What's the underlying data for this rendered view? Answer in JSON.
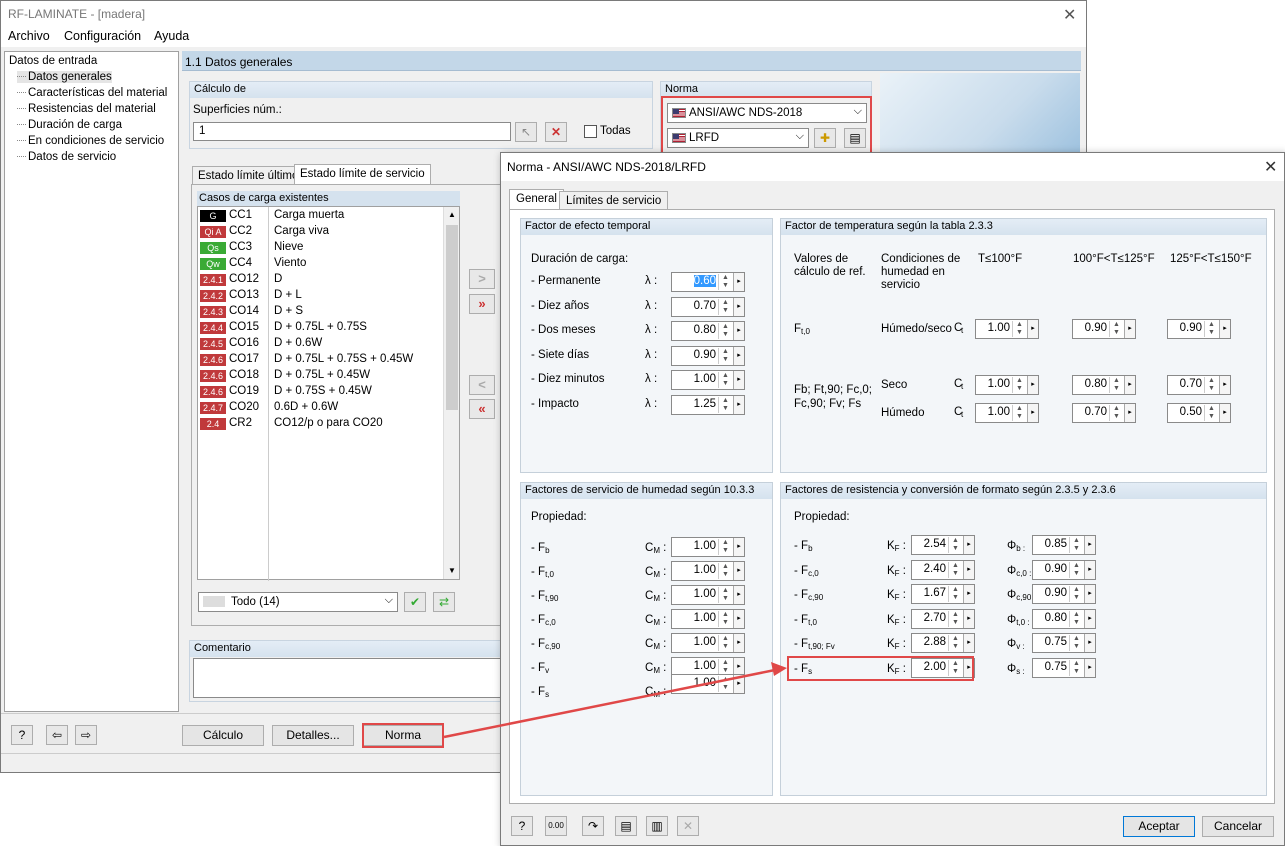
{
  "main": {
    "title": "RF-LAMINATE - [madera]",
    "menu": [
      "Archivo",
      "Configuración",
      "Ayuda"
    ],
    "tree": {
      "root": "Datos de entrada",
      "items": [
        "Datos generales",
        "Características del material",
        "Resistencias del material",
        "Duración de carga",
        "En condiciones de servicio",
        "Datos de servicio"
      ]
    },
    "section_title": "1.1 Datos generales",
    "calc": {
      "header": "Cálculo de",
      "surfaces_label": "Superficies núm.:",
      "surfaces_value": "1",
      "all_label": "Todas"
    },
    "norma": {
      "header": "Norma",
      "standard": "ANSI/AWC NDS-2018",
      "method": "LRFD"
    },
    "tabs": [
      "Estado límite último",
      "Estado límite de servicio"
    ],
    "cases_header": "Casos de carga existentes",
    "cases": [
      {
        "tag": "G",
        "tag_color": "#000000",
        "id": "CC1",
        "desc": "Carga muerta"
      },
      {
        "tag": "Qi A",
        "tag_color": "#c0393b",
        "id": "CC2",
        "desc": "Carga viva"
      },
      {
        "tag": "Qs",
        "tag_color": "#3aaa35",
        "id": "CC3",
        "desc": "Nieve"
      },
      {
        "tag": "Qw",
        "tag_color": "#3aaa35",
        "id": "CC4",
        "desc": "Viento"
      },
      {
        "tag": "2.4.1",
        "tag_color": "#c0393b",
        "id": "CO12",
        "desc": "D"
      },
      {
        "tag": "2.4.2",
        "tag_color": "#c0393b",
        "id": "CO13",
        "desc": "D + L"
      },
      {
        "tag": "2.4.3",
        "tag_color": "#c0393b",
        "id": "CO14",
        "desc": "D + S"
      },
      {
        "tag": "2.4.4",
        "tag_color": "#c0393b",
        "id": "CO15",
        "desc": "D + 0.75L + 0.75S"
      },
      {
        "tag": "2.4.5",
        "tag_color": "#c0393b",
        "id": "CO16",
        "desc": "D + 0.6W"
      },
      {
        "tag": "2.4.6",
        "tag_color": "#c0393b",
        "id": "CO17",
        "desc": "D + 0.75L + 0.75S + 0.45W"
      },
      {
        "tag": "2.4.6",
        "tag_color": "#c0393b",
        "id": "CO18",
        "desc": "D + 0.75L + 0.45W"
      },
      {
        "tag": "2.4.6",
        "tag_color": "#c0393b",
        "id": "CO19",
        "desc": "D + 0.75S + 0.45W"
      },
      {
        "tag": "2.4.7",
        "tag_color": "#c0393b",
        "id": "CO20",
        "desc": "0.6D + 0.6W"
      },
      {
        "tag": "2.4",
        "tag_color": "#c0393b",
        "id": "CR2",
        "desc": "CO12/p o para CO20"
      }
    ],
    "filter": "Todo (14)",
    "comment_label": "Comentario",
    "buttons": {
      "calc": "Cálculo",
      "details": "Detalles...",
      "norma": "Norma"
    }
  },
  "dialog": {
    "title": "Norma - ANSI/AWC NDS-2018/LRFD",
    "tabs": [
      "General",
      "Límites de servicio"
    ],
    "time": {
      "header": "Factor de efecto temporal",
      "label": "Duración de carga:",
      "symbol": "λ :",
      "rows": [
        {
          "name": "- Permanente",
          "value": "0.60"
        },
        {
          "name": "- Diez años",
          "value": "0.70"
        },
        {
          "name": "- Dos meses",
          "value": "0.80"
        },
        {
          "name": "- Siete días",
          "value": "0.90"
        },
        {
          "name": "- Diez minutos",
          "value": "1.00"
        },
        {
          "name": "- Impacto",
          "value": "1.25"
        }
      ]
    },
    "temp": {
      "header": "Factor de temperatura según la tabla 2.3.3",
      "col_values": "Valores de cálculo de ref.",
      "col_cond": "Condiciones de humedad en servicio",
      "col_t1": "T≤100°F",
      "col_t2": "100°F<T≤125°F",
      "col_t3": "125°F<T≤150°F",
      "row1_label": "F",
      "row1_sub": "t,0",
      "row1_cond": "Húmedo/seco",
      "row1_vals": [
        "1.00",
        "0.90",
        "0.90"
      ],
      "row2_label_a": "F",
      "row2_label_b": "b; Ft,90; Fc,0;",
      "row2_label_c": "Fc,90; Fv; Fs",
      "row2_cond": "Seco",
      "row2_vals": [
        "1.00",
        "0.80",
        "0.70"
      ],
      "row3_cond": "Húmedo",
      "row3_vals": [
        "1.00",
        "0.70",
        "0.50"
      ],
      "ct": "C"
    },
    "moist": {
      "header": "Factores de servicio de humedad según 10.3.3",
      "prop": "Propiedad:",
      "rows": [
        {
          "name": "- F",
          "sub": "b",
          "value": "1.00"
        },
        {
          "name": "- F",
          "sub": "t,0",
          "value": "1.00"
        },
        {
          "name": "- F",
          "sub": "t,90",
          "value": "1.00"
        },
        {
          "name": "- F",
          "sub": "c,0",
          "value": "1.00"
        },
        {
          "name": "- F",
          "sub": "c,90",
          "value": "1.00"
        },
        {
          "name": "- F",
          "sub": "v",
          "value": "1.00"
        },
        {
          "name": "- F",
          "sub": "s",
          "value": "1.00"
        }
      ]
    },
    "resist": {
      "header": "Factores de resistencia y conversión de formato según 2.3.5 y 2.3.6",
      "prop": "Propiedad:",
      "rows": [
        {
          "name": "- F",
          "sub": "b",
          "kf": "2.54",
          "phi": "Φ",
          "phisub": "b :",
          "phival": "0.85"
        },
        {
          "name": "- F",
          "sub": "c,0",
          "kf": "2.40",
          "phi": "Φ",
          "phisub": "c,0 :",
          "phival": "0.90"
        },
        {
          "name": "- F",
          "sub": "c,90",
          "kf": "1.67",
          "phi": "Φ",
          "phisub": "c,90 :",
          "phival": "0.90"
        },
        {
          "name": "- F",
          "sub": "t,0",
          "kf": "2.70",
          "phi": "Φ",
          "phisub": "t,0 :",
          "phival": "0.80"
        },
        {
          "name": "- F",
          "sub": "t,90; Fv",
          "kf": "2.88",
          "phi": "Φ",
          "phisub": "v :",
          "phival": "0.75"
        },
        {
          "name": "- F",
          "sub": "s",
          "kf": "2.00",
          "phi": "Φ",
          "phisub": "s :",
          "phival": "0.75"
        }
      ]
    },
    "ok": "Aceptar",
    "cancel": "Cancelar"
  },
  "colors": {
    "accent_red": "#e04848",
    "header_blue": "#c3d7e8"
  }
}
